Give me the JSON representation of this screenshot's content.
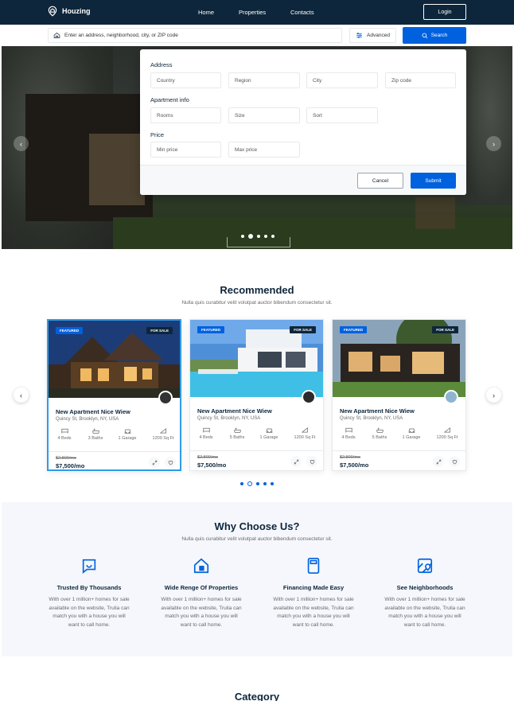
{
  "nav": {
    "brand": "Houzing",
    "links": [
      "Home",
      "Properties",
      "Contacts"
    ],
    "login": "Login"
  },
  "search": {
    "placeholder": "Enter an address, neighborhood, city, or ZIP code",
    "advanced_label": "Advanced",
    "search_label": "Search"
  },
  "advanced_panel": {
    "address_heading": "Address",
    "address_fields": [
      "Country",
      "Region",
      "City",
      "Zip code"
    ],
    "apartment_heading": "Apartment info",
    "apartment_fields": [
      "Rooms",
      "Size",
      "Sort"
    ],
    "price_heading": "Price",
    "price_fields": [
      "Min price",
      "Max price"
    ],
    "cancel": "Cancel",
    "submit": "Submit"
  },
  "hero": {
    "slides": 5,
    "active_slide": 1
  },
  "recommended": {
    "title": "Recommended",
    "subtitle": "Nulla quis curabitur velit volutpat auctor bibendum consectetur sit.",
    "cards": [
      {
        "badge": "FEATURED",
        "status": "FOR SALE",
        "title": "New Apartment Nice Wiew",
        "address": "Quincy St, Brooklyn, NY, USA",
        "beds": "4 Beds",
        "baths": "3 Baths",
        "garage": "1 Garage",
        "area": "1200 Sq Ft",
        "old_price": "$2,800/mo",
        "price": "$7,500/mo"
      },
      {
        "badge": "FEATURED",
        "status": "FOR SALE",
        "title": "New Apartment Nice Wiew",
        "address": "Quincy St, Brooklyn, NY, USA",
        "beds": "4 Beds",
        "baths": "5 Baths",
        "garage": "1 Garage",
        "area": "1200 Sq Ft",
        "old_price": "$2,800/mo",
        "price": "$7,500/mo"
      },
      {
        "badge": "FEATURED",
        "status": "FOR SALE",
        "title": "New Apartment Nice Wiew",
        "address": "Quincy St, Brooklyn, NY, USA",
        "beds": "4 Beds",
        "baths": "5 Baths",
        "garage": "1 Garage",
        "area": "1200 Sq Ft",
        "old_price": "$2,800/mo",
        "price": "$7,500/mo"
      }
    ],
    "dots": 5,
    "active_dot": 1
  },
  "why": {
    "title": "Why Choose Us?",
    "subtitle": "Nulla quis curabitur velit volutpat auctor bibendum consectetur sit.",
    "items": [
      {
        "icon": "chat-smile-icon",
        "heading": "Trusted By Thousands",
        "text": "With over 1 million+ homes for sale available on the website, Trulia can match you with a house you will want to call home."
      },
      {
        "icon": "house-icon",
        "heading": "Wide Renge Of Properties",
        "text": "With over 1 million+ homes for sale available on the website, Trulia can match you with a house you will want to call home."
      },
      {
        "icon": "calculator-icon",
        "heading": "Financing Made Easy",
        "text": "With over 1 million+ homes for sale available on the website, Trulia can match you with a house you will want to call home."
      },
      {
        "icon": "map-pin-icon",
        "heading": "See Neighborhoods",
        "text": "With over 1 million+ homes for sale available on the website, Trulia can match you with a house you will want to call home."
      }
    ]
  },
  "category": {
    "title": "Category"
  },
  "colors": {
    "nav": "#0d263b",
    "primary": "#0061df",
    "selected_border": "#2e9be8",
    "section_bg": "#f5f7fc"
  }
}
